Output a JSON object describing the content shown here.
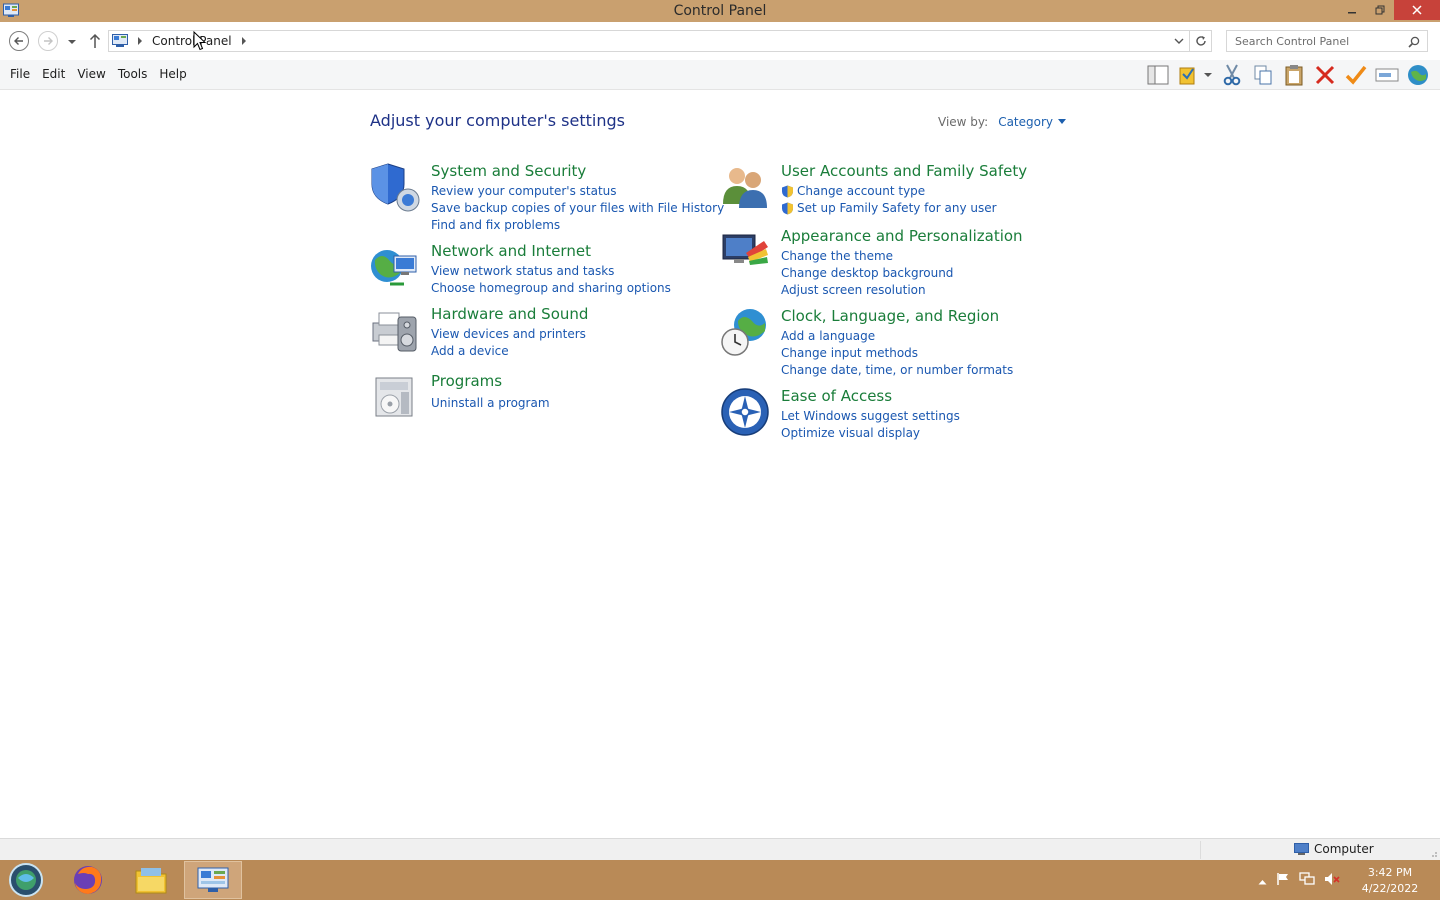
{
  "window": {
    "title": "Control Panel"
  },
  "address": {
    "crumb": "Control Panel",
    "search_placeholder": "Search Control Panel"
  },
  "menu": {
    "items": [
      "File",
      "Edit",
      "View",
      "Tools",
      "Help"
    ]
  },
  "content": {
    "heading": "Adjust your computer's settings",
    "view_by_label": "View by:",
    "view_by_value": "Category",
    "categories": [
      {
        "title": "System and Security",
        "links": [
          "Review your computer's status",
          "Save backup copies of your files with File History",
          "Find and fix problems"
        ]
      },
      {
        "title": "Network and Internet",
        "links": [
          "View network status and tasks",
          "Choose homegroup and sharing options"
        ]
      },
      {
        "title": "Hardware and Sound",
        "links": [
          "View devices and printers",
          "Add a device"
        ]
      },
      {
        "title": "Programs",
        "links": [
          "Uninstall a program"
        ]
      },
      {
        "title": "User Accounts and Family Safety",
        "links": [
          "Change account type",
          "Set up Family Safety for any user"
        ]
      },
      {
        "title": "Appearance and Personalization",
        "links": [
          "Change the theme",
          "Change desktop background",
          "Adjust screen resolution"
        ]
      },
      {
        "title": "Clock, Language, and Region",
        "links": [
          "Add a language",
          "Change input methods",
          "Change date, time, or number formats"
        ]
      },
      {
        "title": "Ease of Access",
        "links": [
          "Let Windows suggest settings",
          "Optimize visual display"
        ]
      }
    ]
  },
  "statusbar": {
    "computer": "Computer"
  },
  "taskbar": {
    "time": "3:42 PM",
    "date": "4/22/2022"
  },
  "colors": {
    "titlebar": "#c9a06f",
    "taskbar": "#b98a57",
    "category_title": "#1a7d3a",
    "link": "#1a57b0",
    "heading": "#1e3287",
    "close": "#c7423a"
  },
  "icons": {
    "toolbar": [
      "pane-icon",
      "properties-icon",
      "cut-icon",
      "copy-icon",
      "paste-icon",
      "delete-icon",
      "checkmark-icon",
      "rename-icon",
      "globe-icon"
    ],
    "taskbar": [
      "start-orb-icon",
      "firefox-icon",
      "file-explorer-icon",
      "control-panel-icon"
    ],
    "tray": [
      "show-hidden-icon",
      "action-center-flag-icon",
      "network-icon",
      "volume-muted-icon"
    ]
  }
}
